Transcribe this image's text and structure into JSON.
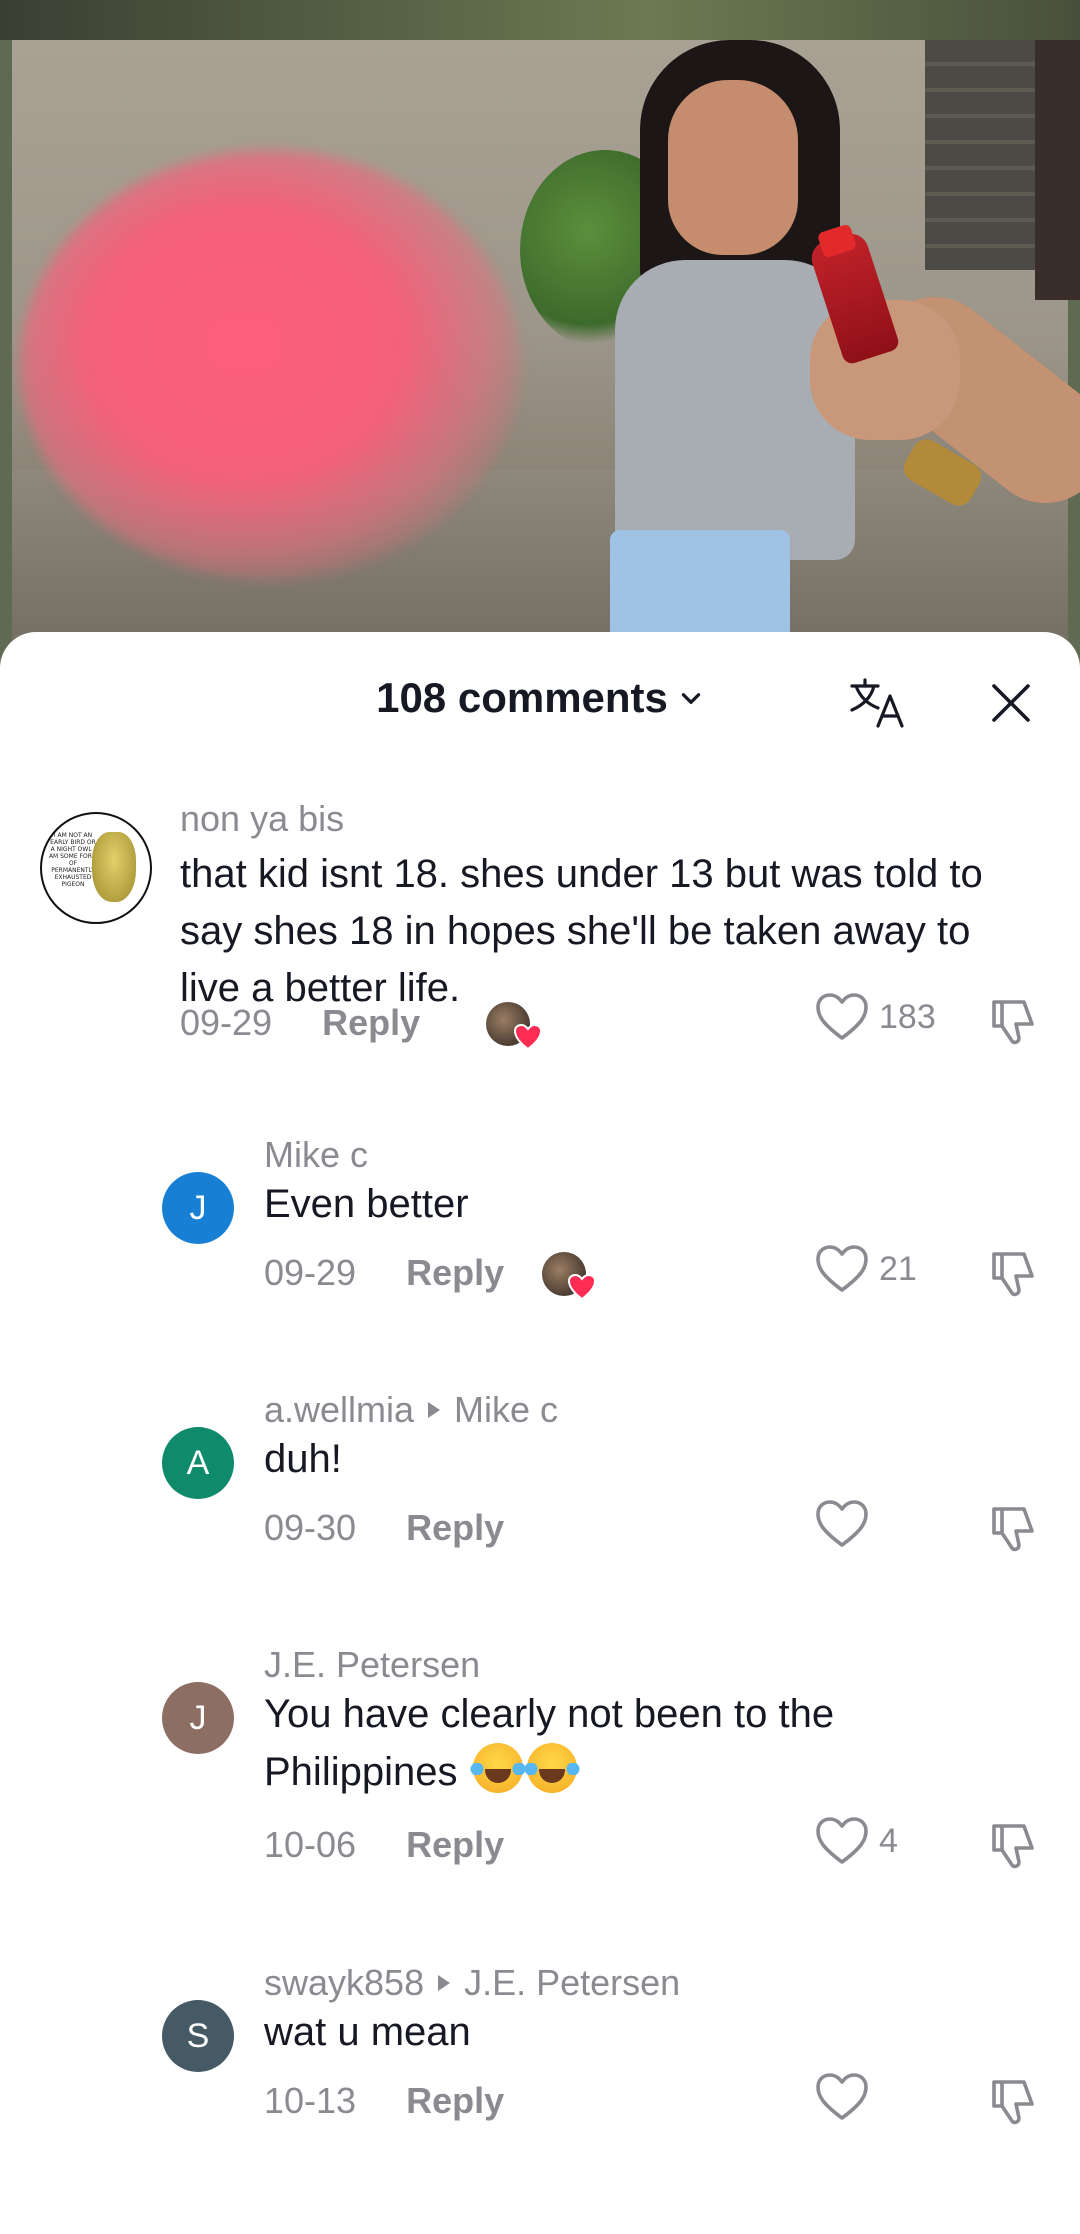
{
  "header": {
    "comments_count_label": "108 comments",
    "chevron_icon": "chevron-down-icon",
    "translate_icon": "translate-icon",
    "close_icon": "close-icon"
  },
  "comments": [
    {
      "avatar_type": "image",
      "avatar_caption": "I AM NOT AN EARLY BIRD OR A NIGHT OWL I AM SOME FORM OF PERMANENTLY EXHAUSTED PIGEON",
      "username": "non ya bis",
      "text": "that kid isnt 18. shes under 13 but was told to say shes 18 in hopes she'll be taken away to live a better life.",
      "date": "09-29",
      "reply_label": "Reply",
      "likes": "183",
      "creator_liked": true
    },
    {
      "avatar_letter": "J",
      "avatar_color": "#1780d4",
      "username": "Mike c",
      "text": "Even better",
      "date": "09-29",
      "reply_label": "Reply",
      "likes": "21",
      "creator_liked": true
    },
    {
      "avatar_letter": "A",
      "avatar_color": "#0f8a6a",
      "username": "a.wellmia",
      "reply_to": "Mike c",
      "text": "duh!",
      "date": "09-30",
      "reply_label": "Reply",
      "likes": ""
    },
    {
      "avatar_letter": "J",
      "avatar_color": "#8d6e63",
      "username": "J.E. Petersen",
      "text_line1": "You have clearly not been to the",
      "text_line2": "Philippines",
      "emojis": "😂😂",
      "date": "10-06",
      "reply_label": "Reply",
      "likes": "4"
    },
    {
      "avatar_letter": "S",
      "avatar_color": "#455a64",
      "username": "swayk858",
      "reply_to": "J.E. Petersen",
      "text": "wat u mean",
      "date": "10-13",
      "reply_label": "Reply",
      "likes": ""
    }
  ]
}
